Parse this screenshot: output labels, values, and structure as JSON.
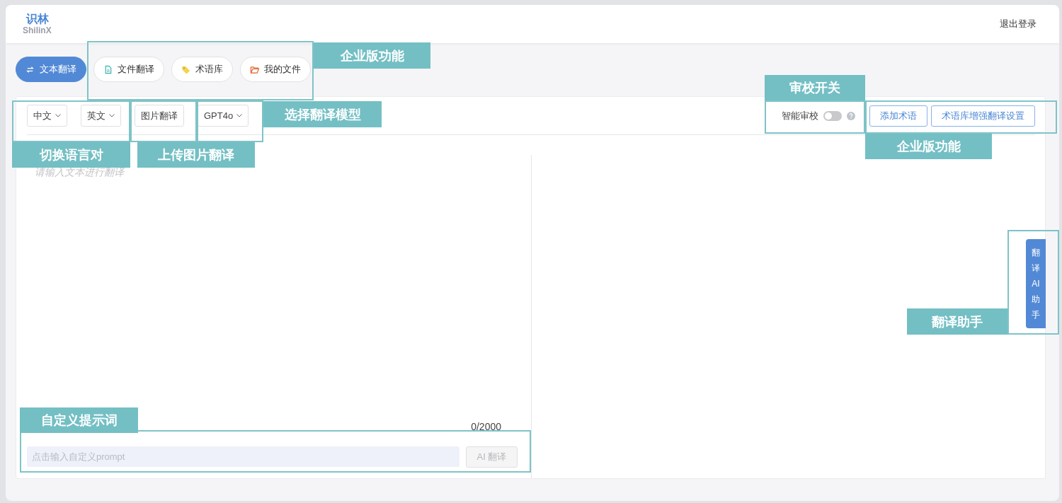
{
  "header": {
    "logo": {
      "title": "识林",
      "subtitle": "ShilinX"
    },
    "logout": "退出登录"
  },
  "tabs": [
    {
      "label": "文本翻译",
      "kind": "swap",
      "selected": true
    },
    {
      "label": "文件翻译",
      "kind": "document",
      "selected": false
    },
    {
      "label": "术语库",
      "kind": "tag",
      "selected": false
    },
    {
      "label": "我的文件",
      "kind": "folder",
      "selected": false
    }
  ],
  "toolbar": {
    "source_language": "中文",
    "target_language": "英文",
    "image_translate": "图片翻译",
    "model": "GPT4o",
    "review": {
      "label": "智能审校",
      "on": false
    },
    "buttons": [
      "添加术语",
      "术语库增强翻译设置"
    ]
  },
  "editor": {
    "placeholder": "请输入文本进行翻译",
    "counter": "0/2000",
    "prompt": {
      "placeholder": "点击输入自定义prompt"
    },
    "translate_button": {
      "label": "AI 翻译",
      "disabled": true
    }
  },
  "assistant_tab": "翻译AI助手",
  "annotations": [
    {
      "label": "企业版功能"
    },
    {
      "label": "切换语言对"
    },
    {
      "label": "上传图片翻译"
    },
    {
      "label": "选择翻译模型"
    },
    {
      "label": "审校开关"
    },
    {
      "label": "企业版功能"
    },
    {
      "label": "翻译助手"
    },
    {
      "label": "自定义提示词"
    }
  ]
}
